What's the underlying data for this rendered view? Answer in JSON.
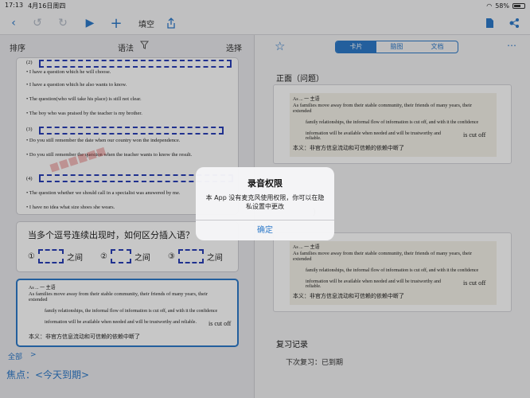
{
  "status": {
    "time": "17:13",
    "date": "4月16日周四",
    "battery": "58%"
  },
  "toolbar": {
    "fill_blank": "填空"
  },
  "left": {
    "sort": "排序",
    "grammar": "语法",
    "select": "选择",
    "questions": [
      "• I have a question which he will choose.",
      "• I have a question which he also wants to know.",
      "• The question(who will take his place) is still not clear.",
      "• The boy who was praised by the teacher is my brother.",
      "• Do you still remember the date when our country won the independence.",
      "• Do you still remember the question when the teacher wants to know the result.",
      "• The question whether we should call in a specialist was answered by me.",
      "• I have no idea what size shoes she wears."
    ],
    "nums": [
      "(2)",
      "(3)",
      "(4)"
    ],
    "card2_heading": "当多个逗号连续出现时，如何区分插入语？",
    "card2_slots": [
      "①",
      "之间",
      "②",
      "之间",
      "③",
      "之间"
    ],
    "note": {
      "heading": "As  ...  一  主语",
      "l1": "As families move away from their stable community, their friends of many years, their extended",
      "l2": "family relationships, the informal flow of information is cut off, and with it the confidence",
      "l3": "information will be available when needed and will be trustworthy and reliable.",
      "tag": "is cut off",
      "cn": "本义：非官方信息流动和可信赖的依赖中断了"
    },
    "all": "全部",
    "chevron": ">",
    "focus": "焦点：<今天到期>"
  },
  "right": {
    "tabs": [
      "卡片",
      "脑图",
      "文档"
    ],
    "front": "正面（问题）",
    "back_partial": "）",
    "review": "复习记录",
    "next_review": "下次复习：已到期"
  },
  "alert": {
    "title": "录音权限",
    "message": "本 App 没有麦克风使用权限，你可以在隐私设置中更改",
    "ok": "确定"
  }
}
